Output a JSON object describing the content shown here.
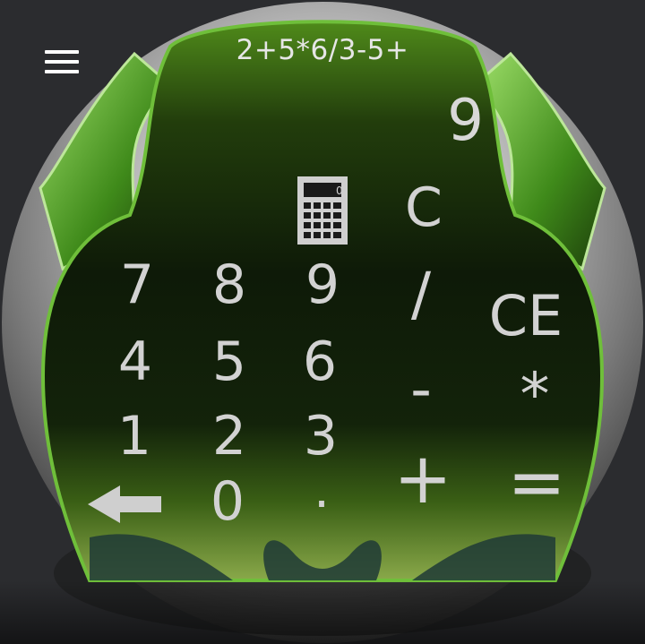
{
  "menu": {
    "icon": "hamburger-menu-icon"
  },
  "display": {
    "expression": "2+5*6/3-5+",
    "result": "9"
  },
  "keys": {
    "digits": {
      "k7": "7",
      "k8": "8",
      "k9": "9",
      "k4": "4",
      "k5": "5",
      "k6": "6",
      "k1": "1",
      "k2": "2",
      "k3": "3",
      "k0": "0",
      "dot": "."
    },
    "ops": {
      "clear": "C",
      "clear_entry": "CE",
      "divide": "/",
      "multiply": "*",
      "minus": "-",
      "plus": "+",
      "equals": "="
    },
    "backspace_icon": "backspace-arrow-icon",
    "mode_icon": "calculator-icon"
  },
  "colors": {
    "background": "#2b2c2f",
    "green_accent": "#4f8a1a",
    "key_text": "#d2d2d2"
  }
}
